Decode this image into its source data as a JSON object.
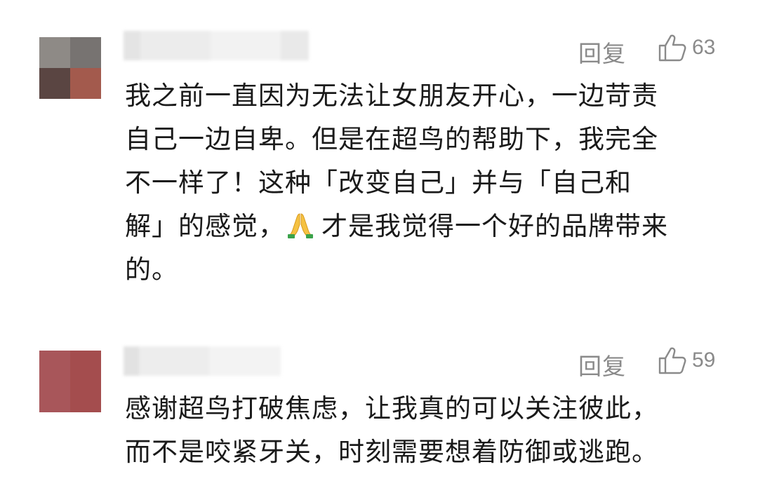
{
  "comments": [
    {
      "reply_label": "回复",
      "like_count": "63",
      "avatar_colors": [
        "#8e8a86",
        "#777371",
        "#5a4542",
        "#a35a4d"
      ],
      "text_lines": [
        "我之前一直因为无法让女朋友开心，一边苛责",
        "自己一边自卑。但是在超鸟的帮助下，我完全",
        "不一样了！这种「改变自己」并与「自己和",
        "解」的感觉，",
        "的。"
      ],
      "text_line4_tail": "才是我觉得一个好的品牌带来",
      "inline_emoji": "folded-hands-emoji"
    },
    {
      "reply_label": "回复",
      "like_count": "59",
      "avatar_colors": [
        "#a8565a",
        "#a44d4e",
        "#a8565a",
        "#a44d4e"
      ],
      "text_lines": [
        "感谢超鸟打破焦虑，让我真的可以关注彼此，",
        "而不是咬紧牙关，时刻需要想着防御或逃跑。"
      ]
    }
  ],
  "colors": {
    "secondary_text": "#8a8a8a",
    "primary_text": "#1a1a1a"
  }
}
